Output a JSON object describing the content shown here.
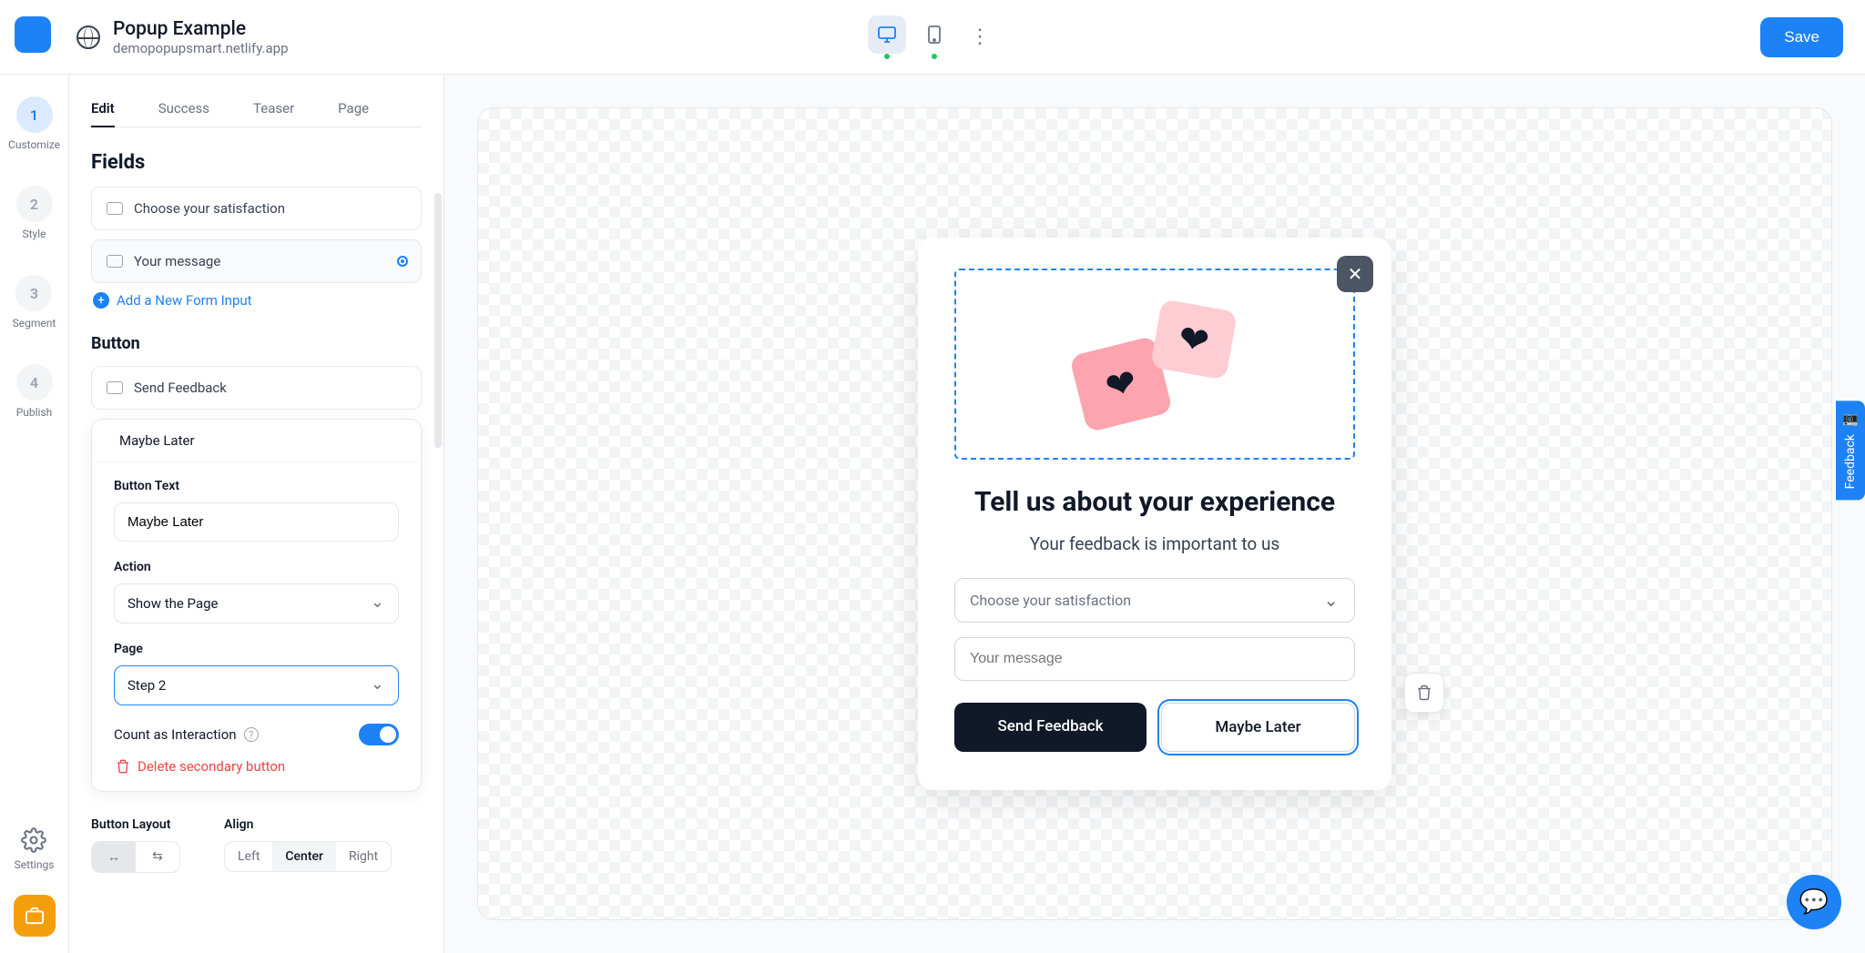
{
  "header": {
    "title": "Popup Example",
    "subtitle": "demopopupsmart.netlify.app",
    "save_label": "Save"
  },
  "rail": {
    "steps": [
      {
        "num": "1",
        "label": "Customize",
        "active": true
      },
      {
        "num": "2",
        "label": "Style",
        "active": false
      },
      {
        "num": "3",
        "label": "Segment",
        "active": false
      },
      {
        "num": "4",
        "label": "Publish",
        "active": false
      }
    ],
    "settings_label": "Settings"
  },
  "panel": {
    "tabs": [
      {
        "label": "Edit",
        "active": true
      },
      {
        "label": "Success",
        "active": false
      },
      {
        "label": "Teaser",
        "active": false
      },
      {
        "label": "Page",
        "active": false
      }
    ],
    "fields_heading": "Fields",
    "field_items": [
      {
        "label": "Choose your satisfaction",
        "selected": false
      },
      {
        "label": "Your message",
        "selected": true
      }
    ],
    "add_link": "Add a New Form Input",
    "button_heading": "Button",
    "button_items": [
      {
        "label": "Send Feedback"
      },
      {
        "label": "Maybe Later"
      }
    ],
    "secondary": {
      "button_text_label": "Button Text",
      "button_text_value": "Maybe Later",
      "action_label": "Action",
      "action_value": "Show the Page",
      "page_label": "Page",
      "page_value": "Step 2",
      "count_label": "Count as Interaction",
      "count_on": true,
      "delete_label": "Delete secondary button"
    },
    "layout": {
      "button_layout_label": "Button Layout",
      "align_label": "Align",
      "align_options": [
        "Left",
        "Center",
        "Right"
      ],
      "align_selected": "Center"
    }
  },
  "popup": {
    "heading": "Tell us about your experience",
    "subheading": "Your feedback is important to us",
    "satisfaction_placeholder": "Choose your satisfaction",
    "message_placeholder": "Your message",
    "primary_label": "Send Feedback",
    "secondary_label": "Maybe Later"
  },
  "feedback_tab": "Feedback"
}
